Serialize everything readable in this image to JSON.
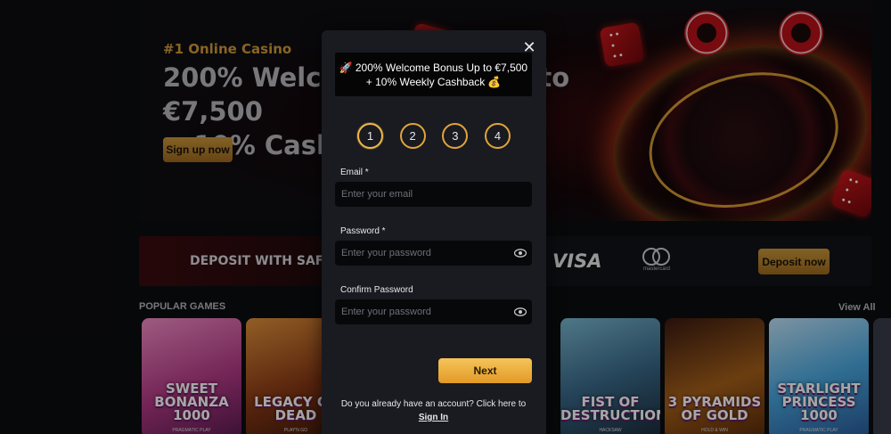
{
  "hero": {
    "tag": "#1 Online Casino",
    "title_line1": "200% Welcome Bonus Up to €7,500",
    "title_line2": "+ 10% Cashback",
    "cta": "Sign up now"
  },
  "banner": {
    "text": "DEPOSIT WITH SAFETY",
    "visa": "VISA",
    "mastercard": "mastercard",
    "cta": "Deposit now"
  },
  "games_section": {
    "title": "POPULAR GAMES",
    "view_all": "View All",
    "games": [
      {
        "title": "SWEET BONANZA 1000",
        "provider": "PRAGMATIC PLAY",
        "color": "#e85fa6"
      },
      {
        "title": "LEGACY OF DEAD",
        "provider": "PLAY'N GO",
        "color": "#8a3a16"
      },
      {
        "title": "FIST OF DESTRUCTION",
        "provider": "HACKSAW",
        "color": "#3a6a8a"
      },
      {
        "title": "3 PYRAMIDS OF GOLD",
        "provider": "HOLD & WIN",
        "color": "#a5601a"
      },
      {
        "title": "STARLIGHT PRINCESS 1000",
        "provider": "PRAGMATIC PLAY",
        "color": "#4aa8e0"
      }
    ]
  },
  "modal": {
    "promo_line1": "200% Welcome Bonus Up to €7,500",
    "promo_line2": "+ 10% Weekly Cashback",
    "steps": [
      "1",
      "2",
      "3",
      "4"
    ],
    "current_step": "1",
    "email_label": "Email *",
    "email_placeholder": "Enter your email",
    "password_label": "Password *",
    "password_placeholder": "Enter your password",
    "confirm_label": "Confirm Password",
    "confirm_placeholder": "Enter your password",
    "next": "Next",
    "signin_prompt": "Do you already have an account? Click here to",
    "signin_link": "Sign In",
    "close": "✕"
  },
  "colors": {
    "accent": "#e2a43a",
    "button_gradient_top": "#f6c45a",
    "modal_bg": "#191b21",
    "page_bg": "#0c0d10"
  }
}
